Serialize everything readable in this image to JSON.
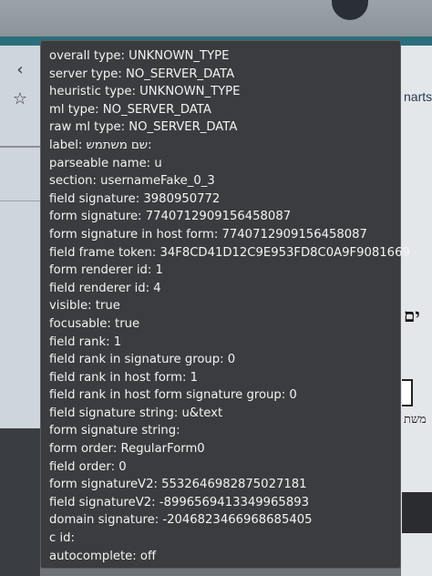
{
  "browser": {
    "star_icon": "star-icon",
    "right_partial_text": "narts",
    "right_hebrew_heading": "ים",
    "right_hebrew_text": "משת"
  },
  "tooltip": {
    "lines": [
      "overall type: UNKNOWN_TYPE",
      "server type: NO_SERVER_DATA",
      "heuristic type: UNKNOWN_TYPE",
      "ml type: NO_SERVER_DATA",
      "raw ml type: NO_SERVER_DATA",
      "label: שם משתמש:",
      "parseable name: u",
      "section: usernameFake_0_3",
      "field signature: 3980950772",
      "form signature: 7740712909156458087",
      "form signature in host form: 7740712909156458087",
      "field frame token: 34F8CD41D12C9E953FD8C0A9F9081669",
      "form renderer id: 1",
      "field renderer id: 4",
      "visible: true",
      "focusable: true",
      "field rank: 1",
      "field rank in signature group: 0",
      "field rank in host form: 1",
      "field rank in host form signature group: 0",
      "field signature string: u&text",
      "form signature string:",
      "form order: RegularForm0",
      "field order: 0",
      "form signatureV2: 5532646982875027181",
      "field signatureV2: -8996569413349965893",
      "domain signature: -2046823466968685405",
      "c id:",
      "autocomplete: off"
    ]
  }
}
